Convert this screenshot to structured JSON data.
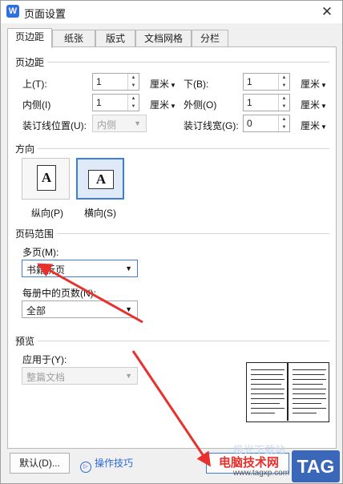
{
  "window": {
    "title": "页面设置",
    "close_glyph": "✕",
    "app_icon_letter": "W"
  },
  "tabs": [
    {
      "label": "页边距",
      "active": true
    },
    {
      "label": "纸张",
      "active": false
    },
    {
      "label": "版式",
      "active": false
    },
    {
      "label": "文档网格",
      "active": false
    },
    {
      "label": "分栏",
      "active": false
    }
  ],
  "margins": {
    "section_title": "页边距",
    "top": {
      "label": "上(T):",
      "value": "1",
      "unit": "厘米"
    },
    "bottom": {
      "label": "下(B):",
      "value": "1",
      "unit": "厘米"
    },
    "inside": {
      "label": "内侧(I)",
      "value": "1",
      "unit": "厘米"
    },
    "outside": {
      "label": "外侧(O)",
      "value": "1",
      "unit": "厘米"
    },
    "gutter_position": {
      "label": "装订线位置(U):",
      "value": "内侧"
    },
    "gutter_width": {
      "label": "装订线宽(G):",
      "value": "0",
      "unit": "厘米"
    },
    "caret_glyph": "▼",
    "spin_up_glyph": "▲",
    "spin_down_glyph": "▼"
  },
  "orientation": {
    "section_title": "方向",
    "portrait_label": "纵向(P)",
    "landscape_label": "横向(S)",
    "page_letter": "A",
    "selected": "landscape"
  },
  "page_range": {
    "section_title": "页码范围",
    "multiple_pages_label": "多页(M):",
    "multiple_pages_value": "书籍折页",
    "pages_per_booklet_label": "每册中的页数(N):",
    "pages_per_booklet_value": "全部"
  },
  "preview": {
    "section_title": "预览",
    "apply_to_label": "应用于(Y):",
    "apply_to_value": "整篇文档"
  },
  "footer": {
    "default_button": "默认(D)...",
    "tips_icon": "▷",
    "tips_label": "操作技巧"
  },
  "watermark": {
    "site_name": "电脑技术网",
    "url": "www.tagxp.com",
    "tag": "TAG",
    "faint_text": "极光下载站"
  },
  "colors": {
    "accent_blue": "#3c7fd6",
    "annotation_arrow": "#e8302c",
    "link_blue": "#2b6ad9"
  }
}
